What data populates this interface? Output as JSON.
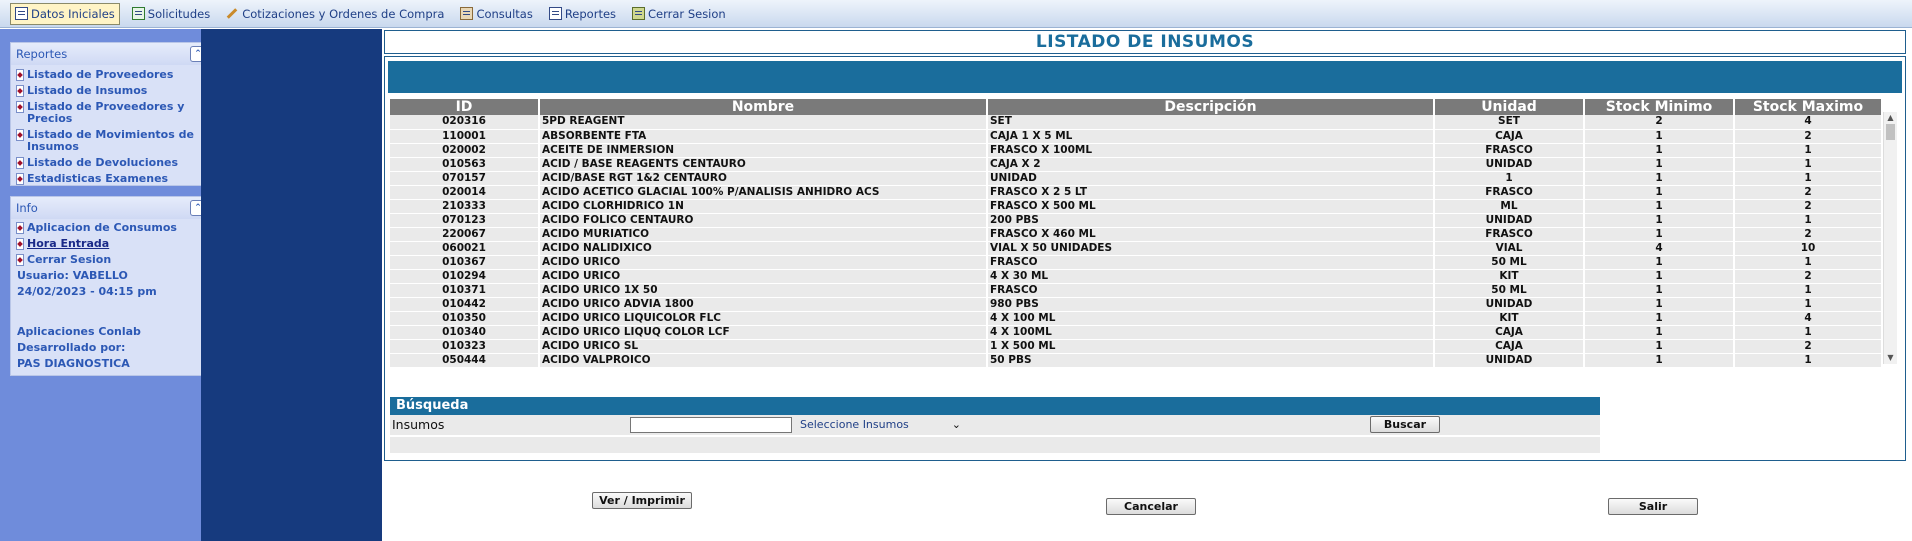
{
  "menu": [
    {
      "label": "Datos Iniciales",
      "icon": "book-icon",
      "active": true
    },
    {
      "label": "Solicitudes",
      "icon": "sheet-icon"
    },
    {
      "label": "Cotizaciones y Ordenes de Compra",
      "icon": "pencil-icon"
    },
    {
      "label": "Consultas",
      "icon": "computer-icon"
    },
    {
      "label": "Reportes",
      "icon": "report-icon"
    },
    {
      "label": "Cerrar Sesion",
      "icon": "exit-icon"
    }
  ],
  "reportes": {
    "title": "Reportes",
    "items": [
      "Listado de Proveedores",
      "Listado de Insumos",
      "Listado de Proveedores y Precios",
      "Listado de Movimientos de Insumos",
      "Listado de Devoluciones",
      "Estadisticas Examenes"
    ]
  },
  "info": {
    "title": "Info",
    "links": [
      "Aplicacion de Consumos",
      "Hora Entrada",
      "Cerrar Sesion"
    ],
    "user": "Usuario: VABELLO",
    "datetime": "24/02/2023 - 04:15 pm",
    "app_line": "Aplicaciones Conlab",
    "dev_line": "Desarrollado por:",
    "company": "PAS DIAGNOSTICA"
  },
  "page_title": "LISTADO DE INSUMOS",
  "table": {
    "columns": [
      "ID",
      "Nombre",
      "Descripción",
      "Unidad",
      "Stock Minimo",
      "Stock Maximo"
    ],
    "rows": [
      [
        "020316",
        "5PD REAGENT",
        "SET",
        "SET",
        "2",
        "4"
      ],
      [
        "110001",
        "ABSORBENTE FTA",
        "CAJA 1 X 5 ML",
        "CAJA",
        "1",
        "2"
      ],
      [
        "020002",
        "ACEITE DE INMERSION",
        "FRASCO X 100ML",
        "FRASCO",
        "1",
        "1"
      ],
      [
        "010563",
        "ACID / BASE REAGENTS CENTAURO",
        "CAJA X 2",
        "UNIDAD",
        "1",
        "1"
      ],
      [
        "070157",
        "ACID/BASE RGT 1&2 CENTAURO",
        "UNIDAD",
        "1",
        "1",
        "1"
      ],
      [
        "020014",
        "ACIDO ACETICO GLACIAL 100% P/ANALISIS ANHIDRO ACS",
        "FRASCO X 2 5 LT",
        "FRASCO",
        "1",
        "2"
      ],
      [
        "210333",
        "ACIDO CLORHIDRICO 1N",
        "FRASCO X 500 ML",
        "ML",
        "1",
        "2"
      ],
      [
        "070123",
        "ACIDO FOLICO CENTAURO",
        "200 PBS",
        "UNIDAD",
        "1",
        "1"
      ],
      [
        "220067",
        "ACIDO MURIATICO",
        "FRASCO X 460 ML",
        "FRASCO",
        "1",
        "2"
      ],
      [
        "060021",
        "ACIDO NALIDIXICO",
        "VIAL X 50 UNIDADES",
        "VIAL",
        "4",
        "10"
      ],
      [
        "010367",
        "ACIDO URICO",
        "FRASCO",
        "50 ML",
        "1",
        "1"
      ],
      [
        "010294",
        "ACIDO URICO",
        "4 X 30 ML",
        "KIT",
        "1",
        "2"
      ],
      [
        "010371",
        "ACIDO URICO 1X 50",
        "FRASCO",
        "50 ML",
        "1",
        "1"
      ],
      [
        "010442",
        "ACIDO URICO ADVIA 1800",
        "980 PBS",
        "UNIDAD",
        "1",
        "1"
      ],
      [
        "010350",
        "ACIDO URICO LIQUICOLOR FLC",
        "4 X 100 ML",
        "KIT",
        "1",
        "4"
      ],
      [
        "010340",
        "ACIDO URICO LIQUQ COLOR LCF",
        "4 X 100ML",
        "CAJA",
        "1",
        "1"
      ],
      [
        "010323",
        "ACIDO URICO SL",
        "1 X 500 ML",
        "CAJA",
        "1",
        "2"
      ],
      [
        "050444",
        "ACIDO VALPROICO",
        "50 PBS",
        "UNIDAD",
        "1",
        "1"
      ]
    ]
  },
  "busqueda": {
    "title": "Búsqueda",
    "label": "Insumos",
    "input_value": "",
    "select_value": "Seleccione Insumos",
    "search_button": "Buscar"
  },
  "buttons": {
    "print": "Ver / Imprimir",
    "cancel": "Cancelar",
    "exit": "Salir"
  }
}
